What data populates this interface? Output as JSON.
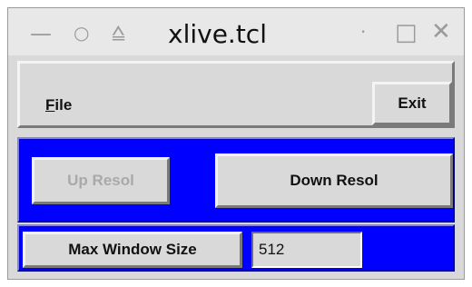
{
  "window": {
    "title": "xlive.tcl"
  },
  "titlebar": {
    "icons": [
      "minimize-icon",
      "circle-icon",
      "maximize-icon",
      "dot-icon",
      "square-icon",
      "close-icon"
    ]
  },
  "menubar": {
    "file_label_rest": "ile",
    "file_mnemonic": "F",
    "exit_label": "Exit"
  },
  "resolution": {
    "up_label": "Up Resol",
    "down_label": "Down Resol",
    "up_disabled": true
  },
  "window_size": {
    "label": "Max Window Size",
    "value": "512"
  },
  "colors": {
    "frame_blue": "#0000ff",
    "widget_gray": "#d9d9d9",
    "disabled_text": "#a9a9a9"
  }
}
